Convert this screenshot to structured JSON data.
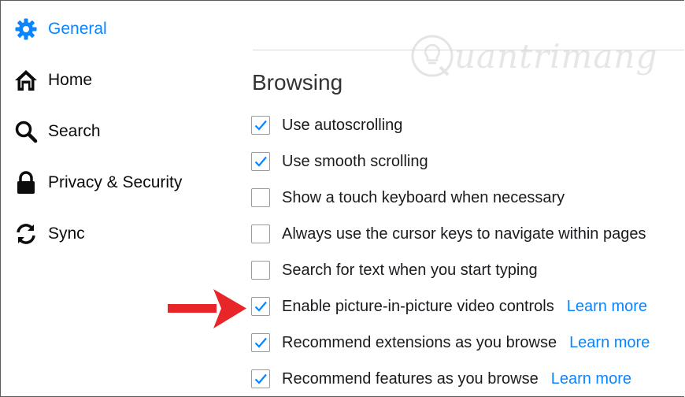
{
  "sidebar": {
    "items": [
      {
        "label": "General",
        "icon": "gear-icon"
      },
      {
        "label": "Home",
        "icon": "home-icon"
      },
      {
        "label": "Search",
        "icon": "search-icon"
      },
      {
        "label": "Privacy & Security",
        "icon": "lock-icon"
      },
      {
        "label": "Sync",
        "icon": "sync-icon"
      }
    ]
  },
  "main": {
    "heading": "Browsing",
    "options": [
      {
        "label": "Use autoscrolling",
        "checked": true
      },
      {
        "label": "Use smooth scrolling",
        "checked": true
      },
      {
        "label": "Show a touch keyboard when necessary",
        "checked": false
      },
      {
        "label": "Always use the cursor keys to navigate within pages",
        "checked": false
      },
      {
        "label": "Search for text when you start typing",
        "checked": false
      },
      {
        "label": "Enable picture-in-picture video controls",
        "checked": true,
        "link": "Learn more"
      },
      {
        "label": "Recommend extensions as you browse",
        "checked": true,
        "link": "Learn more"
      },
      {
        "label": "Recommend features as you browse",
        "checked": true,
        "link": "Learn more"
      }
    ]
  },
  "watermark": {
    "text": "uantrimang"
  },
  "colors": {
    "accent": "#0a84ff",
    "arrow": "#e8262a"
  }
}
